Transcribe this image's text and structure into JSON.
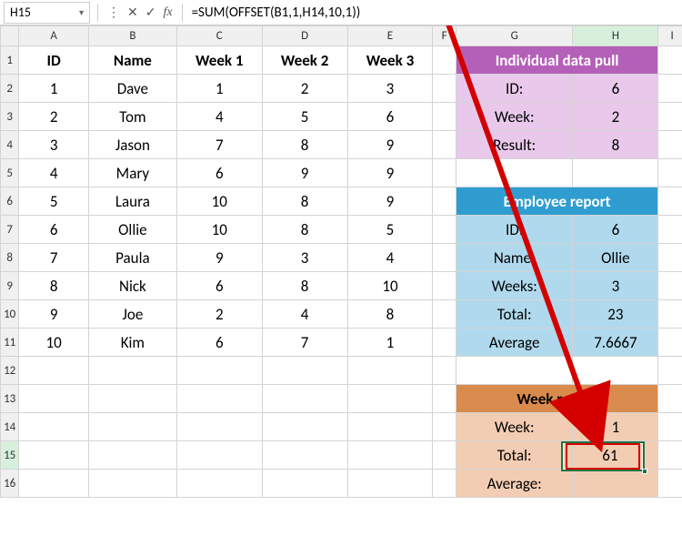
{
  "formula_bar": {
    "cell_ref": "H15",
    "formula": "=SUM(OFFSET(B1,1,H14,10,1))"
  },
  "columns": {
    "A": "A",
    "B": "B",
    "C": "C",
    "D": "D",
    "E": "E",
    "F": "F",
    "G": "G",
    "H": "H",
    "I": "I"
  },
  "headers": {
    "id": "ID",
    "name": "Name",
    "w1": "Week 1",
    "w2": "Week 2",
    "w3": "Week 3"
  },
  "data_rows": [
    {
      "id": "1",
      "name": "Dave",
      "w1": "1",
      "w2": "2",
      "w3": "3"
    },
    {
      "id": "2",
      "name": "Tom",
      "w1": "4",
      "w2": "5",
      "w3": "6"
    },
    {
      "id": "3",
      "name": "Jason",
      "w1": "7",
      "w2": "8",
      "w3": "9"
    },
    {
      "id": "4",
      "name": "Mary",
      "w1": "6",
      "w2": "9",
      "w3": "9"
    },
    {
      "id": "5",
      "name": "Laura",
      "w1": "10",
      "w2": "8",
      "w3": "9"
    },
    {
      "id": "6",
      "name": "Ollie",
      "w1": "10",
      "w2": "8",
      "w3": "5"
    },
    {
      "id": "7",
      "name": "Paula",
      "w1": "9",
      "w2": "3",
      "w3": "4"
    },
    {
      "id": "8",
      "name": "Nick",
      "w1": "6",
      "w2": "8",
      "w3": "10"
    },
    {
      "id": "9",
      "name": "Joe",
      "w1": "2",
      "w2": "4",
      "w3": "8"
    },
    {
      "id": "10",
      "name": "Kim",
      "w1": "6",
      "w2": "7",
      "w3": "1"
    }
  ],
  "panel1": {
    "title": "Individual data pull",
    "id_label": "ID:",
    "id_val": "6",
    "week_label": "Week:",
    "week_val": "2",
    "result_label": "Result:",
    "result_val": "8"
  },
  "panel2": {
    "title": "Employee report",
    "id_label": "ID:",
    "id_val": "6",
    "name_label": "Name:",
    "name_val": "Ollie",
    "weeks_label": "Weeks:",
    "weeks_val": "3",
    "total_label": "Total:",
    "total_val": "23",
    "avg_label": "Average",
    "avg_val": "7.6667"
  },
  "panel3": {
    "title": "Week report",
    "week_label": "Week:",
    "week_val": "1",
    "total_label": "Total:",
    "total_val": "61",
    "avg_label": "Average:",
    "avg_val": ""
  }
}
